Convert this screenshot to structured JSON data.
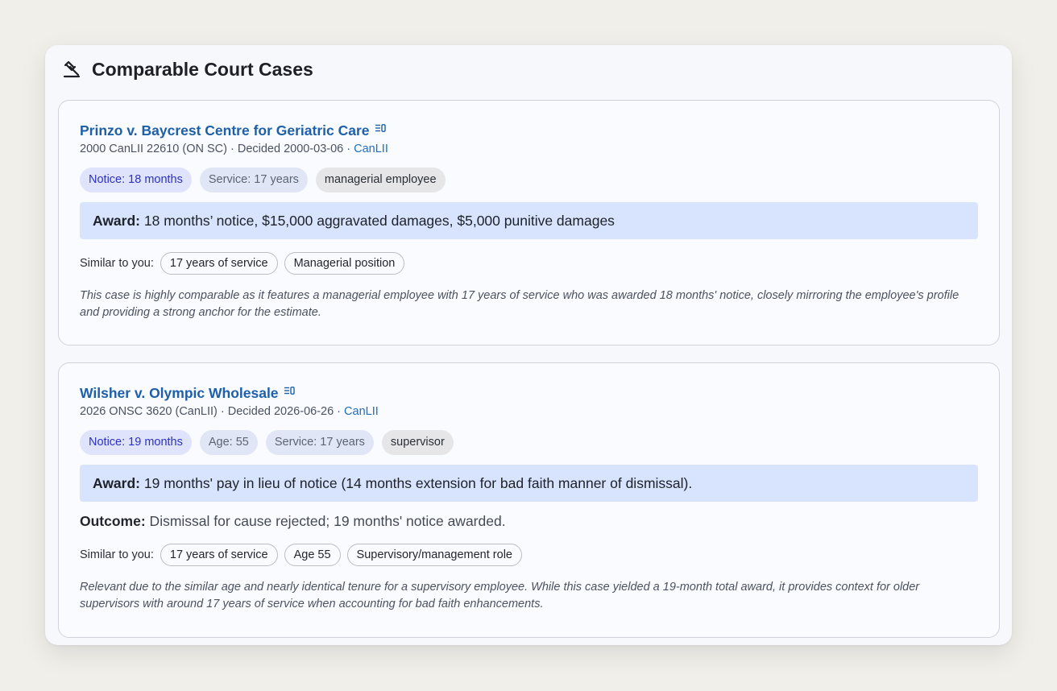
{
  "panel": {
    "title": "Comparable Court Cases",
    "icon": "gavel-icon"
  },
  "cases": [
    {
      "title": "Prinzo v. Baycrest Centre for Geriatric Care",
      "citation": "2000 CanLII 22610 (ON SC) · Decided 2000-03-06 · ",
      "link_label": "CanLII",
      "tags": {
        "notice": "Notice: 18 months",
        "service": "Service: 17 years",
        "role": "managerial employee"
      },
      "award_label": "Award:",
      "award_text": " 18 months’ notice, $15,000 aggravated damages, $5,000 punitive damages",
      "similar_label": "Similar to you:",
      "similar": [
        "17 years of service",
        "Managerial position"
      ],
      "rationale": "This case is highly comparable as it features a managerial employee with 17 years of service who was awarded 18 months' notice, closely mirroring the employee's profile and providing a strong anchor for the estimate."
    },
    {
      "title": "Wilsher v. Olympic Wholesale",
      "citation": "2026 ONSC 3620 (CanLII) · Decided 2026-06-26 · ",
      "link_label": "CanLII",
      "tags": {
        "notice": "Notice: 19 months",
        "age": "Age: 55",
        "service": "Service: 17 years",
        "role": "supervisor"
      },
      "award_label": "Award:",
      "award_text": " 19 months' pay in lieu of notice (14 months extension for bad faith manner of dismissal).",
      "outcome_label": "Outcome:",
      "outcome_text": " Dismissal for cause rejected; 19 months' notice awarded.",
      "similar_label": "Similar to you:",
      "similar": [
        "17 years of service",
        "Age 55",
        "Supervisory/management role"
      ],
      "rationale": "Relevant due to the similar age and nearly identical tenure for a supervisory employee. While this case yielded a 19-month total award, it provides context for older supervisors with around 17 years of service when accounting for bad faith enhancements."
    }
  ]
}
